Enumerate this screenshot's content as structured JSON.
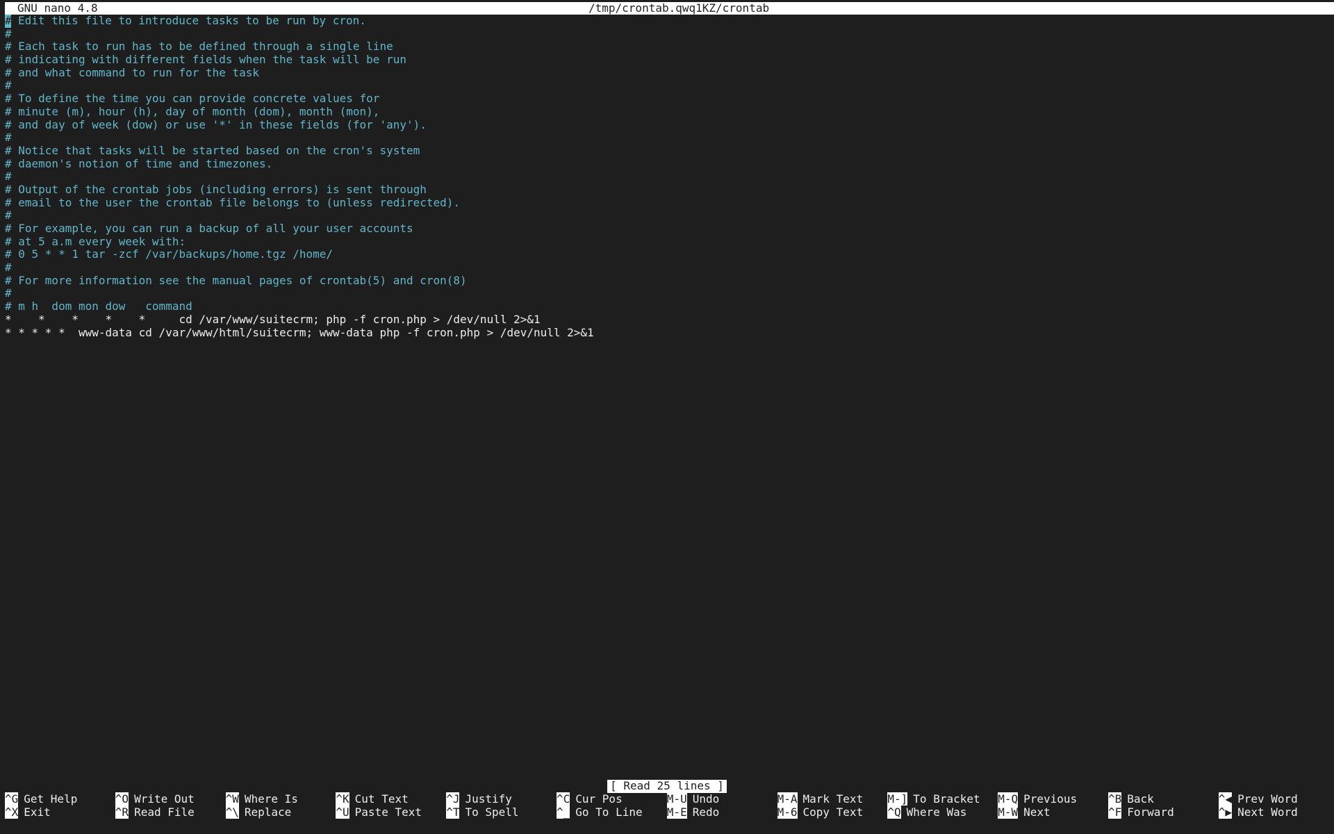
{
  "titlebar": {
    "app_version": "GNU nano 4.8",
    "filename": "/tmp/crontab.qwq1KZ/crontab"
  },
  "editor": {
    "cursor_char": "#",
    "lines": [
      {
        "text": " Edit this file to introduce tasks to be run by cron.",
        "kind": "comment"
      },
      {
        "text": "#",
        "kind": "comment"
      },
      {
        "text": "# Each task to run has to be defined through a single line",
        "kind": "comment"
      },
      {
        "text": "# indicating with different fields when the task will be run",
        "kind": "comment"
      },
      {
        "text": "# and what command to run for the task",
        "kind": "comment"
      },
      {
        "text": "#",
        "kind": "comment"
      },
      {
        "text": "# To define the time you can provide concrete values for",
        "kind": "comment"
      },
      {
        "text": "# minute (m), hour (h), day of month (dom), month (mon),",
        "kind": "comment"
      },
      {
        "text": "# and day of week (dow) or use '*' in these fields (for 'any').",
        "kind": "comment"
      },
      {
        "text": "#",
        "kind": "comment"
      },
      {
        "text": "# Notice that tasks will be started based on the cron's system",
        "kind": "comment"
      },
      {
        "text": "# daemon's notion of time and timezones.",
        "kind": "comment"
      },
      {
        "text": "#",
        "kind": "comment"
      },
      {
        "text": "# Output of the crontab jobs (including errors) is sent through",
        "kind": "comment"
      },
      {
        "text": "# email to the user the crontab file belongs to (unless redirected).",
        "kind": "comment"
      },
      {
        "text": "#",
        "kind": "comment"
      },
      {
        "text": "# For example, you can run a backup of all your user accounts",
        "kind": "comment"
      },
      {
        "text": "# at 5 a.m every week with:",
        "kind": "comment"
      },
      {
        "text": "# 0 5 * * 1 tar -zcf /var/backups/home.tgz /home/",
        "kind": "comment"
      },
      {
        "text": "#",
        "kind": "comment"
      },
      {
        "text": "# For more information see the manual pages of crontab(5) and cron(8)",
        "kind": "comment"
      },
      {
        "text": "#",
        "kind": "comment"
      },
      {
        "text": "# m h  dom mon dow   command",
        "kind": "comment"
      },
      {
        "text": "*    *    *    *    *     cd /var/www/suitecrm; php -f cron.php > /dev/null 2>&1",
        "kind": "code"
      },
      {
        "text": "* * * * *  www-data cd /var/www/html/suitecrm; www-data php -f cron.php > /dev/null 2>&1",
        "kind": "code"
      }
    ]
  },
  "status": {
    "message": "[ Read 25 lines ]"
  },
  "shortcuts": [
    {
      "key": "^G",
      "label": "Get Help",
      "name": "get-help"
    },
    {
      "key": "^X",
      "label": "Exit",
      "name": "exit"
    },
    {
      "key": "^O",
      "label": "Write Out",
      "name": "write-out"
    },
    {
      "key": "^R",
      "label": "Read File",
      "name": "read-file"
    },
    {
      "key": "^W",
      "label": "Where Is",
      "name": "where-is"
    },
    {
      "key": "^\\",
      "label": "Replace",
      "name": "replace"
    },
    {
      "key": "^K",
      "label": "Cut Text",
      "name": "cut-text"
    },
    {
      "key": "^U",
      "label": "Paste Text",
      "name": "paste-text"
    },
    {
      "key": "^J",
      "label": "Justify",
      "name": "justify"
    },
    {
      "key": "^T",
      "label": "To Spell",
      "name": "to-spell"
    },
    {
      "key": "^C",
      "label": "Cur Pos",
      "name": "cur-pos"
    },
    {
      "key": "^_",
      "label": "Go To Line",
      "name": "go-to-line"
    },
    {
      "key": "M-U",
      "label": "Undo",
      "name": "undo"
    },
    {
      "key": "M-E",
      "label": "Redo",
      "name": "redo"
    },
    {
      "key": "M-A",
      "label": "Mark Text",
      "name": "mark-text"
    },
    {
      "key": "M-6",
      "label": "Copy Text",
      "name": "copy-text"
    },
    {
      "key": "M-]",
      "label": "To Bracket",
      "name": "to-bracket"
    },
    {
      "key": "^Q",
      "label": "Where Was",
      "name": "where-was"
    },
    {
      "key": "M-Q",
      "label": "Previous",
      "name": "previous"
    },
    {
      "key": "M-W",
      "label": "Next",
      "name": "next"
    },
    {
      "key": "^B",
      "label": "Back",
      "name": "back"
    },
    {
      "key": "^F",
      "label": "Forward",
      "name": "forward"
    },
    {
      "key": "^◀",
      "label": "Prev Word",
      "name": "prev-word"
    },
    {
      "key": "^▶",
      "label": "Next Word",
      "name": "next-word"
    }
  ],
  "colors": {
    "background": "#1e1e1e",
    "comment": "#62b6c9",
    "code": "#eeeeee",
    "inverse_bg": "#ffffff"
  }
}
